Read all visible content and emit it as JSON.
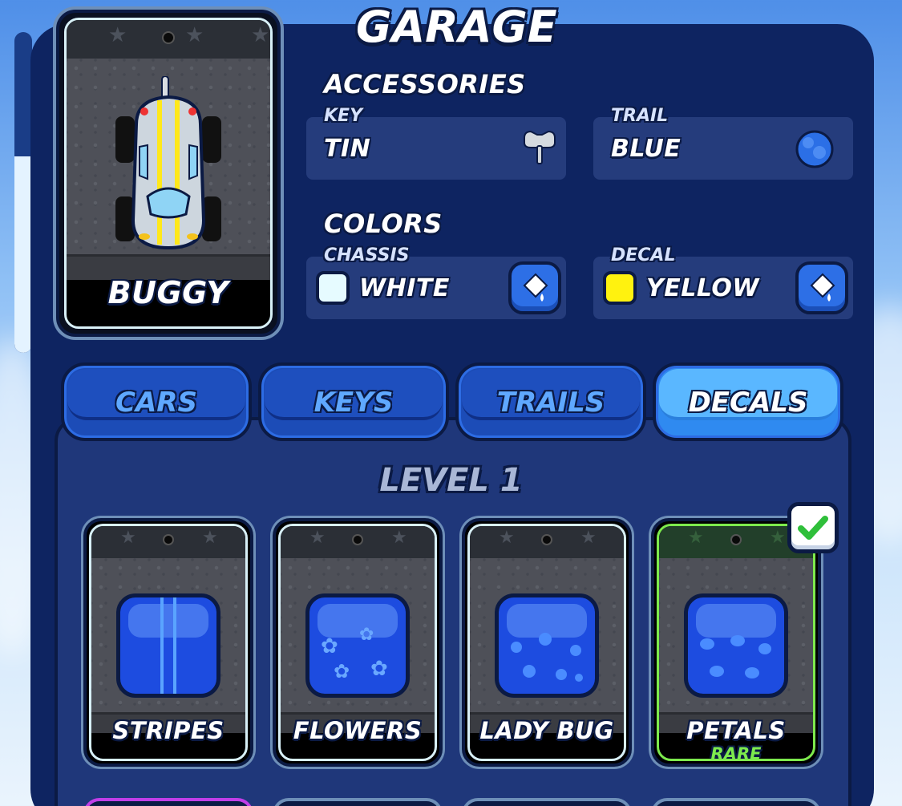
{
  "title": "GARAGE",
  "car": {
    "name": "BUGGY"
  },
  "accessories": {
    "title": "ACCESSORIES",
    "key": {
      "label": "KEY",
      "value": "TIN",
      "icon": "wind-up-key-icon"
    },
    "trail": {
      "label": "TRAIL",
      "value": "BLUE",
      "icon": "blue-puff-icon"
    }
  },
  "colors": {
    "title": "COLORS",
    "chassis": {
      "label": "CHASSIS",
      "value": "WHITE",
      "swatch": "#e6fbff",
      "icon": "paint-bucket-icon"
    },
    "decal": {
      "label": "DECAL",
      "value": "YELLOW",
      "swatch": "#fff20f",
      "icon": "paint-bucket-icon"
    }
  },
  "tabs": [
    {
      "label": "CARS",
      "active": false
    },
    {
      "label": "KEYS",
      "active": false
    },
    {
      "label": "TRAILS",
      "active": false
    },
    {
      "label": "DECALS",
      "active": true
    }
  ],
  "level": "LEVEL 1",
  "decals": [
    {
      "name": "STRIPES",
      "pattern": "stripes"
    },
    {
      "name": "FLOWERS",
      "pattern": "flowers"
    },
    {
      "name": "LADY BUG",
      "pattern": "dots"
    },
    {
      "name": "PETALS",
      "pattern": "petals",
      "rarity": "RARE",
      "selected": true
    }
  ],
  "colors_ui": {
    "accent": "#2f8af0",
    "panel": "#0e2461",
    "selected": "#7dea4d"
  }
}
